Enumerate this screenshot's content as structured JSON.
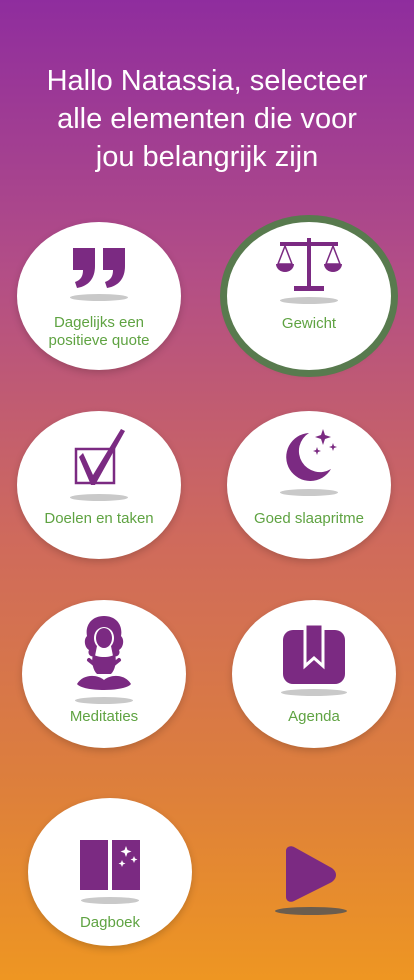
{
  "header": {
    "title_lines": [
      "Hallo Natassia, selecteer",
      "alle elementen die voor",
      "jou belangrijk zijn"
    ]
  },
  "colors": {
    "accent": "#7b2a82",
    "label": "#5fa342",
    "selected_ring": "#587a4e"
  },
  "items": [
    {
      "label": "Dagelijks een positieve quote",
      "icon": "quote-icon",
      "selected": false
    },
    {
      "label": "Gewicht",
      "icon": "scale-icon",
      "selected": true
    },
    {
      "label": "Doelen en taken",
      "icon": "checkbox-icon",
      "selected": false
    },
    {
      "label": "Goed slaapritme",
      "icon": "moon-stars-icon",
      "selected": false
    },
    {
      "label": "Meditaties",
      "icon": "meditation-icon",
      "selected": false
    },
    {
      "label": "Agenda",
      "icon": "bookmark-icon",
      "selected": false
    },
    {
      "label": "Dagboek",
      "icon": "diary-book-icon",
      "selected": false
    }
  ],
  "next_button": {
    "icon": "play-icon"
  }
}
